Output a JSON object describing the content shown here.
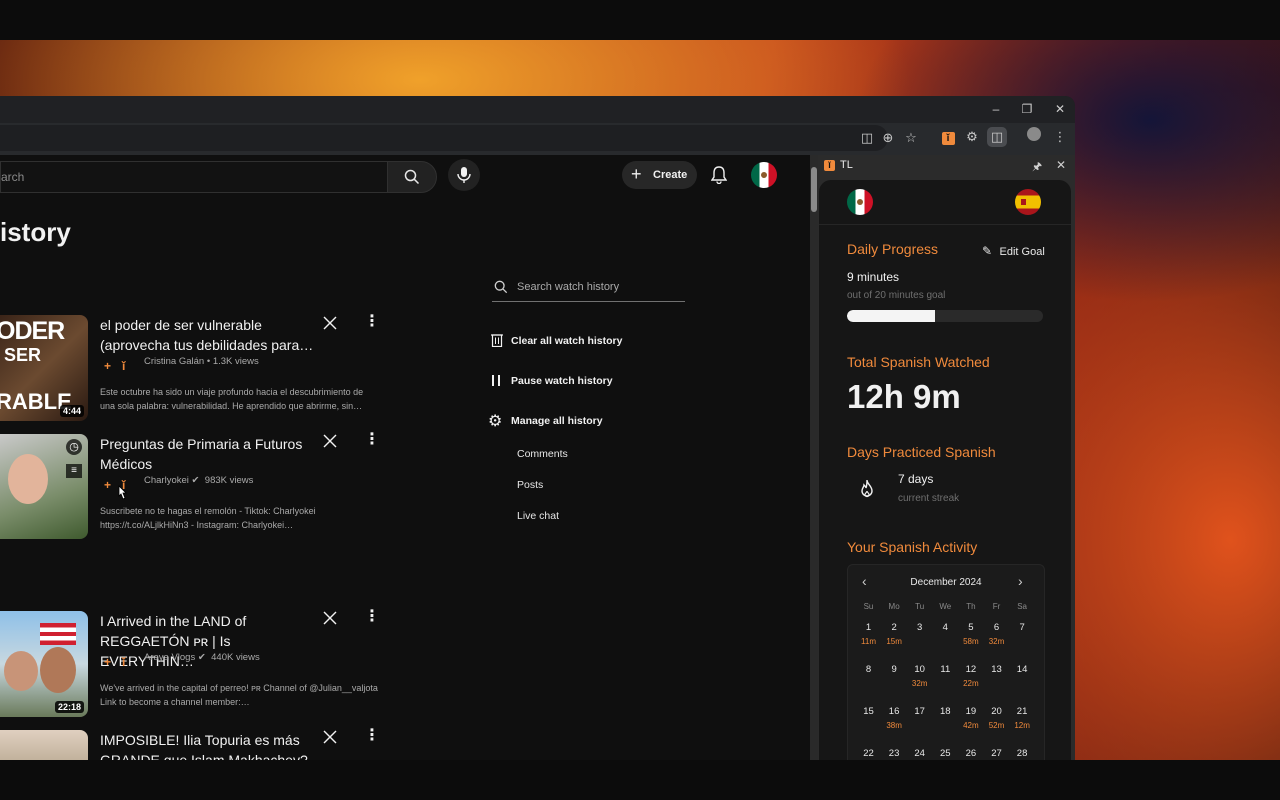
{
  "colors": {
    "accent": "#f08a3c",
    "yt_bg": "#0f0f0f",
    "panel_bg": "#161616"
  },
  "youtube": {
    "search_placeholder": "Search",
    "search_partial": "arch",
    "create_label": "Create",
    "page_title_partial": "istory",
    "history_search_placeholder": "Search watch history",
    "menu": {
      "clear": "Clear all watch history",
      "pause": "Pause watch history",
      "manage": "Manage all history",
      "comments": "Comments",
      "posts": "Posts",
      "live_chat": "Live chat"
    },
    "videos": [
      {
        "title_line1": "el poder de ser vulnerable",
        "title_line2": "(aprovecha tus debilidades para…",
        "channel": "Cristina Galán",
        "views": "1.3K views",
        "desc_line1": "Este octubre ha sido un viaje profundo hacia el descubrimiento de",
        "desc_line2": "una sola palabra: vulnerabilidad. He aprendido que abrirme, sin…",
        "duration": "4:44",
        "thumb_text1": "ODER",
        "thumb_text2": "SER",
        "thumb_text3": "RABLE"
      },
      {
        "title_line1": "Preguntas de Primaria a Futuros",
        "title_line2": "Médicos",
        "channel": "Charlyokei",
        "views": "983K views",
        "desc_line1": "Suscribete no te hagas el remolón - Tiktok: Charlyokei",
        "desc_line2": "https://t.co/ALjlkHiNn3 - Instagram: Charlyokei…"
      },
      {
        "title_line1": "I Arrived in the LAND of",
        "title_line2": "REGGAETÓN ᴘʀ | Is EVERYTHIN…",
        "channel": "Araya Vlogs",
        "views": "440K views",
        "desc_line1": "We've arrived in the capital of perreo! ᴘʀ Channel of @Julian__valjota",
        "desc_line2": "Link to become a channel member:…",
        "duration": "22:18"
      },
      {
        "title_line1": "IMPOSIBLE! Ilia Topuria es más",
        "title_line2": "GRANDE que Islam Makhachev?"
      }
    ],
    "sep": "•"
  },
  "sidepanel": {
    "title": "TL",
    "logo_char": "ĭ",
    "daily_progress": "Daily Progress",
    "edit_goal": "Edit Goal",
    "minutes": "9 minutes",
    "goal_text": "out of 20 minutes goal",
    "progress_fraction": 0.45,
    "total_label": "Total Spanish Watched",
    "total_value": "12h 9m",
    "days_label": "Days Practiced Spanish",
    "streak_days": "7 days",
    "streak_text": "current streak",
    "activity_label": "Your Spanish Activity",
    "calendar": {
      "month": "December 2024",
      "weekdays": [
        "Su",
        "Mo",
        "Tu",
        "We",
        "Th",
        "Fr",
        "Sa"
      ],
      "weeks": [
        [
          {
            "d": "1",
            "m": "11m"
          },
          {
            "d": "2",
            "m": "15m"
          },
          {
            "d": "3",
            "m": ""
          },
          {
            "d": "4",
            "m": ""
          },
          {
            "d": "5",
            "m": "58m"
          },
          {
            "d": "6",
            "m": "32m"
          },
          {
            "d": "7",
            "m": ""
          }
        ],
        [
          {
            "d": "8",
            "m": ""
          },
          {
            "d": "9",
            "m": ""
          },
          {
            "d": "10",
            "m": "32m"
          },
          {
            "d": "11",
            "m": ""
          },
          {
            "d": "12",
            "m": "22m"
          },
          {
            "d": "13",
            "m": ""
          },
          {
            "d": "14",
            "m": ""
          }
        ],
        [
          {
            "d": "15",
            "m": ""
          },
          {
            "d": "16",
            "m": "38m"
          },
          {
            "d": "17",
            "m": ""
          },
          {
            "d": "18",
            "m": ""
          },
          {
            "d": "19",
            "m": "42m"
          },
          {
            "d": "20",
            "m": "52m"
          },
          {
            "d": "21",
            "m": "12m"
          }
        ],
        [
          {
            "d": "22",
            "m": ""
          },
          {
            "d": "23",
            "m": ""
          },
          {
            "d": "24",
            "m": ""
          },
          {
            "d": "25",
            "m": ""
          },
          {
            "d": "26",
            "m": ""
          },
          {
            "d": "27",
            "m": ""
          },
          {
            "d": "28",
            "m": ""
          }
        ]
      ]
    }
  }
}
